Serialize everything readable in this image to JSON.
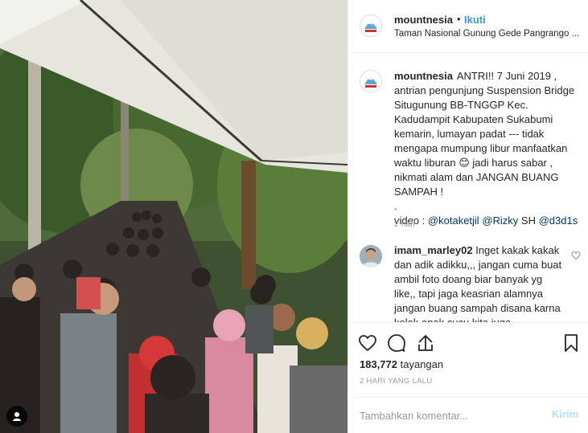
{
  "post": {
    "username": "mountnesia",
    "dot": "•",
    "follow_label": "Ikuti",
    "location": "Taman Nasional Gunung Gede Pangrango ..."
  },
  "caption": {
    "username": "mountnesia",
    "text_1": "ANTRI!! 7 Juni 2019 , antrian pengunjung Suspension Bridge Situgunung BB-TNGGP Kec. Kadudampit Kabupaten Sukabumi kemarin, lumayan padat --- tidak mengapa mumpung libur manfaatkan waktu liburan ",
    "emoji": "😊",
    "text_2": " jadi harus sabar , nikmati alam dan JANGAN BUANG SAMPAH !",
    "dot_line": ".",
    "video_prefix": "video : ",
    "mention_1": "@kotaketjil",
    "mention_2": "@Rizky",
    "sh_text": " SH ",
    "mention_3": "@d3d1s",
    "time": "2 hari"
  },
  "comment": {
    "username": "imam_marley02",
    "text": "Inget kakak kakak dan adik adikku,,, jangan cuma buat ambil foto doang biar banyak yg like,, tapi jaga keasrian alamnya jangan buang sampah disana karna kelak anak cucu kita juga"
  },
  "stats": {
    "views_count": "183,772",
    "views_label": "tayangan",
    "date": "2 HARI YANG LALU"
  },
  "add_comment": {
    "placeholder": "Tambahkan komentar...",
    "send_label": "Kirim"
  },
  "icons": {
    "like": "heart-icon",
    "comment": "comment-icon",
    "share": "share-icon",
    "save": "bookmark-icon",
    "video": "video-camera-icon",
    "comment_like": "small-heart-icon"
  },
  "colors": {
    "link": "#3897f0",
    "mention": "#003569",
    "muted": "#999999",
    "send_disabled": "#b2dffc"
  }
}
